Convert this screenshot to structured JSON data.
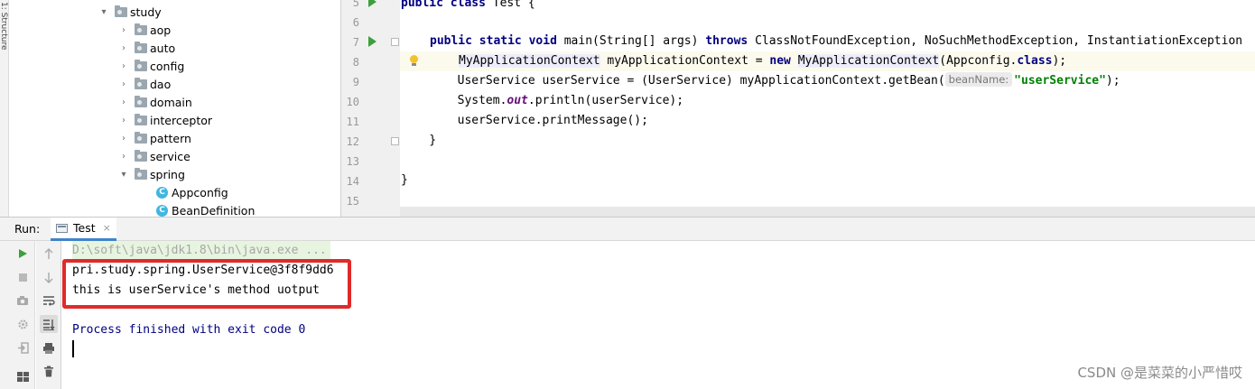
{
  "structure_tab_label": "1: Structure",
  "project_tree": {
    "root": "study",
    "folders": [
      "aop",
      "auto",
      "config",
      "dao",
      "domain",
      "interceptor",
      "pattern",
      "service"
    ],
    "open_folder": "spring",
    "classes": [
      "Appconfig",
      "BeanDefinition"
    ],
    "class_icon_letter": "C"
  },
  "editor": {
    "line_numbers": [
      "5",
      "6",
      "7",
      "8",
      "9",
      "10",
      "11",
      "12",
      "13",
      "14",
      "15"
    ],
    "line5": {
      "kw1": "public ",
      "kw2": "class ",
      "name": "Test {"
    },
    "line7": {
      "kw1": "public ",
      "kw2": "static ",
      "kw3": "void ",
      "sig": "main(String[] args) ",
      "kw4": "throws ",
      "exceptions": "ClassNotFoundException, NoSuchMethodException, InstantiationException"
    },
    "line8": {
      "indent": "        ",
      "type1": "MyApplicationContext",
      "mid": " myApplicationContext = ",
      "kw": "new ",
      "type2": "MyApplicationContext",
      "arg": "(Appconfig.",
      "kw2": "class",
      "end": ");"
    },
    "line9": {
      "code": "        UserService userService = (UserService) myApplicationContext.getBean(",
      "hint": "beanName:",
      "str": "\"userService\"",
      "end": ");"
    },
    "line10": {
      "pre": "        System.",
      "static": "out",
      "post": ".println(userService);"
    },
    "line11": "        userService.printMessage();",
    "line12": "    }",
    "line14": "}"
  },
  "run_panel": {
    "label": "Run:",
    "tab": "Test",
    "tab_close": "×"
  },
  "console": {
    "command": "D:\\soft\\java\\jdk1.8\\bin\\java.exe ...",
    "output": [
      "pri.study.spring.UserService@3f8f9dd6",
      "this is userService's method uotput"
    ],
    "exit_message": "Process finished with exit code 0"
  },
  "watermark": "CSDN @是菜菜的小严惜哎",
  "colors": {
    "keyword": "#000080",
    "string": "#008000",
    "run_green": "#3ca03c",
    "highlight_box": "#e02a2a",
    "tab_underline": "#4083c9"
  }
}
